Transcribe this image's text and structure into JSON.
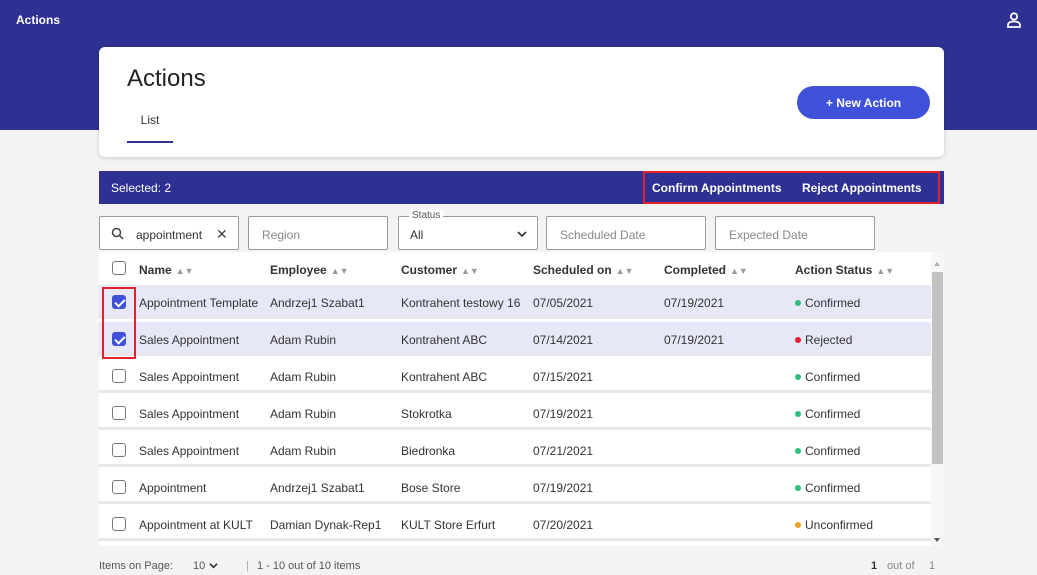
{
  "app": {
    "title": "Actions"
  },
  "header": {
    "title": "Actions",
    "tab": "List",
    "new_action_label": "+ New Action"
  },
  "selection": {
    "text": "Selected: 2",
    "confirm_label": "Confirm Appointments",
    "reject_label": "Reject Appointments"
  },
  "filters": {
    "search_value": "appointment",
    "region_placeholder": "Region",
    "status_label": "Status",
    "status_value": "All",
    "scheduled_placeholder": "Scheduled Date",
    "expected_placeholder": "Expected Date"
  },
  "table": {
    "headers": [
      "Name",
      "Employee",
      "Customer",
      "Scheduled on",
      "Completed",
      "Action Status"
    ],
    "rows": [
      {
        "name": "Appointment Template",
        "employee": "Andrzej1 Szabat1",
        "customer": "Kontrahent testowy 16",
        "scheduled": "07/05/2021",
        "completed": "07/19/2021",
        "status": "Confirmed",
        "status_color": "#2bbf7a",
        "selected": true
      },
      {
        "name": "Sales Appointment",
        "employee": "Adam Rubin",
        "customer": "Kontrahent ABC",
        "scheduled": "07/14/2021",
        "completed": "07/19/2021",
        "status": "Rejected",
        "status_color": "#e0202a",
        "selected": true
      },
      {
        "name": "Sales Appointment",
        "employee": "Adam Rubin",
        "customer": "Kontrahent ABC",
        "scheduled": "07/15/2021",
        "completed": "",
        "status": "Confirmed",
        "status_color": "#2bbf7a",
        "selected": false
      },
      {
        "name": "Sales Appointment",
        "employee": "Adam Rubin",
        "customer": "Stokrotka",
        "scheduled": "07/19/2021",
        "completed": "",
        "status": "Confirmed",
        "status_color": "#2bbf7a",
        "selected": false
      },
      {
        "name": "Sales Appointment",
        "employee": "Adam Rubin",
        "customer": "Biedronka",
        "scheduled": "07/21/2021",
        "completed": "",
        "status": "Confirmed",
        "status_color": "#2bbf7a",
        "selected": false
      },
      {
        "name": "Appointment",
        "employee": "Andrzej1 Szabat1",
        "customer": "Bose Store",
        "scheduled": "07/19/2021",
        "completed": "",
        "status": "Confirmed",
        "status_color": "#2bbf7a",
        "selected": false
      },
      {
        "name": "Appointment at KULT",
        "employee": "Damian Dynak-Rep1",
        "customer": "KULT Store Erfurt",
        "scheduled": "07/20/2021",
        "completed": "",
        "status": "Unconfirmed",
        "status_color": "#f2a024",
        "selected": false
      }
    ]
  },
  "pager": {
    "items_label": "Items on Page:",
    "page_size": "10",
    "separator": "|",
    "range": "1 - 10 out of 10 items",
    "current_page": "1",
    "out_of": "out of",
    "total_pages": "1"
  },
  "colors": {
    "brand": "#2e3192",
    "accent": "#3f51d8",
    "highlight": "#e0202a"
  },
  "icons": {
    "user": "user-icon",
    "search": "search-icon",
    "clear": "close-icon",
    "dropdown": "chevron-down-icon"
  }
}
